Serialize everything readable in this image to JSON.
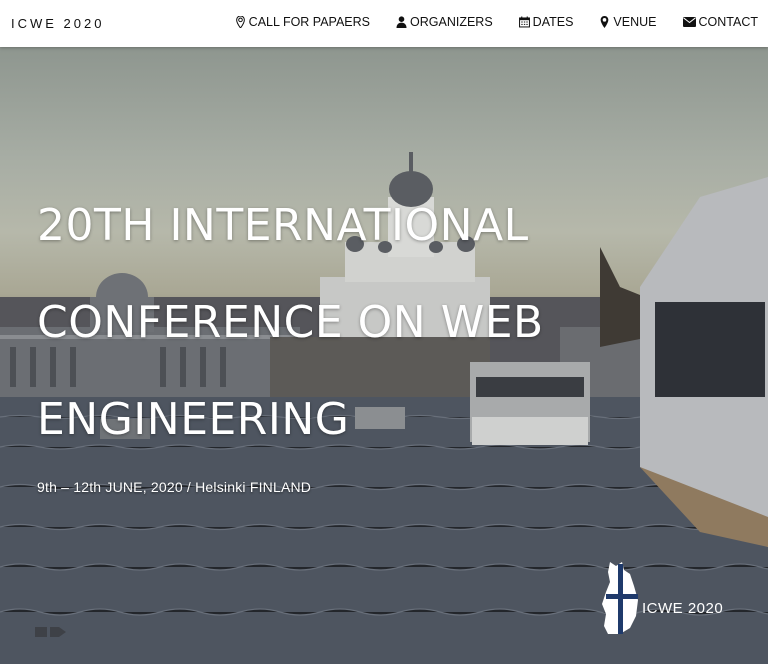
{
  "brand": "ICWE 2020",
  "nav": [
    {
      "label": "CALL FOR PAPAERS",
      "icon": "map-marker-icon"
    },
    {
      "label": "ORGANIZERS",
      "icon": "user-icon"
    },
    {
      "label": "DATES",
      "icon": "calendar-icon"
    },
    {
      "label": "VENUE",
      "icon": "map-marker-icon"
    },
    {
      "label": "CONTACT",
      "icon": "envelope-icon"
    }
  ],
  "hero": {
    "title_lines": [
      "20TH INTERNATIONAL",
      "CONFERENCE ON WEB",
      "ENGINEERING"
    ],
    "dates": "9th – 12th JUNE, 2020 / Helsinki FINLAND",
    "logo_text": "ICWE 2020"
  },
  "colors": {
    "navbar_bg": "#ffffff",
    "nav_text": "#111111",
    "hero_text": "#ffffff",
    "logo_blue": "#1f3a6b"
  }
}
